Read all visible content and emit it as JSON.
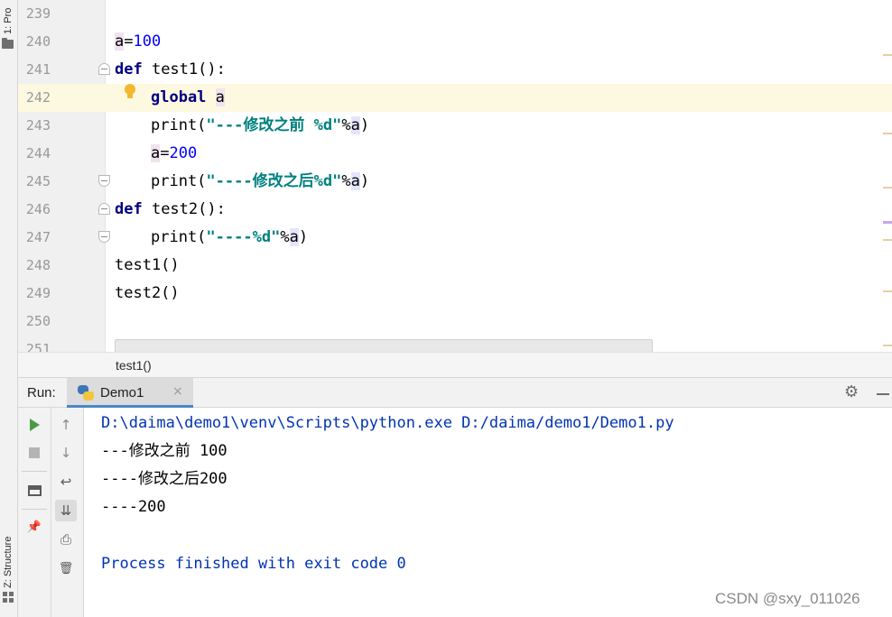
{
  "tool_windows": {
    "project_label": "1: Pro",
    "structure_label": "Z: Structure"
  },
  "editor": {
    "lines": [
      {
        "num": "239",
        "text": ""
      },
      {
        "num": "240",
        "text": "a=100"
      },
      {
        "num": "241",
        "text": "def test1():"
      },
      {
        "num": "242",
        "text": "global a"
      },
      {
        "num": "243",
        "text": "print(\"---修改之前 %d\"%a)"
      },
      {
        "num": "244",
        "text": "a=200"
      },
      {
        "num": "245",
        "text": "print(\"----修改之后%d\"%a)"
      },
      {
        "num": "246",
        "text": "def test2():"
      },
      {
        "num": "247",
        "text": "print(\"----%d\"%a)"
      },
      {
        "num": "248",
        "text": "test1()"
      },
      {
        "num": "249",
        "text": "test2()"
      },
      {
        "num": "250",
        "text": ""
      },
      {
        "num": "251",
        "text": ""
      }
    ],
    "tokens": {
      "l240_var": "a",
      "l240_eq": "=",
      "l240_val": "100",
      "def": "def",
      "l241_name": " test1():",
      "global": "global",
      "l242_var": "a",
      "print": "print(",
      "l243_str": "\"---修改之前 %d\"",
      "pct": "%",
      "a": "a",
      "close": ")",
      "l244_var": "a",
      "l244_eq": "=",
      "l244_val": "200",
      "l245_str": "\"----修改之后%d\"",
      "l246_name": " test2():",
      "l247_str": "\"----%d\""
    },
    "current_line": "242"
  },
  "breadcrumb": {
    "item": "test1()"
  },
  "run": {
    "label": "Run:",
    "tab_label": "Demo1",
    "close_glyph": "×",
    "gear_glyph": "⚙",
    "toolbar": {
      "up_glyph": "↑",
      "down_glyph": "↓",
      "wrap_glyph": "↩",
      "scroll_glyph": "⇊",
      "print_glyph": "⎙",
      "trash_glyph": "🗑",
      "pin_glyph": "📌"
    },
    "console": {
      "command": "D:\\daima\\demo1\\venv\\Scripts\\python.exe D:/daima/demo1/Demo1.py",
      "out1": "---修改之前 100",
      "out2": "----修改之后200",
      "out3": "----200",
      "exit": "Process finished with exit code 0"
    }
  },
  "watermark": "CSDN @sxy_011026"
}
